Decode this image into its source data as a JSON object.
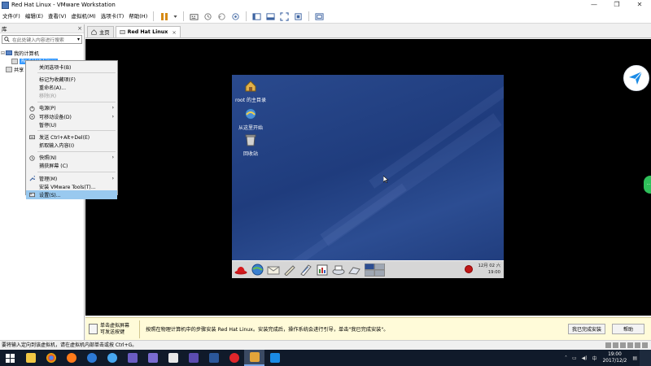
{
  "window": {
    "title": "Red Hat Linux - VMware Workstation",
    "controls": [
      "—",
      "❐",
      "✕"
    ]
  },
  "menubar": {
    "items": [
      "文件(F)",
      "编辑(E)",
      "查看(V)",
      "虚拟机(M)",
      "选项卡(T)",
      "帮助(H)"
    ]
  },
  "library": {
    "title": "库",
    "close": "×",
    "search_placeholder": "在此处键入内容进行搜索",
    "tree": {
      "root_label": "我的计算机",
      "selected_label": "Red Hat Linux",
      "shared_label": "共享"
    }
  },
  "tabs": [
    {
      "label": "主页",
      "active": false
    },
    {
      "label": "Red Hat Linux",
      "active": true,
      "close": "×"
    }
  ],
  "context_menu": {
    "items": [
      {
        "label": "关闭选项卡(B)",
        "disabled": false
      },
      {
        "label": "标记为收藏项(F)",
        "disabled": false,
        "sep_before": true
      },
      {
        "label": "重命名(A)...",
        "disabled": false
      },
      {
        "label": "移除(R)",
        "disabled": true
      },
      {
        "label": "电源(P)",
        "disabled": false,
        "sep_before": true,
        "submenu": true,
        "icon": "power-icon"
      },
      {
        "label": "可移动设备(D)",
        "disabled": false,
        "submenu": true,
        "icon": "disk-icon"
      },
      {
        "label": "暂停(U)",
        "disabled": false
      },
      {
        "label": "发送 Ctrl+Alt+Del(E)",
        "disabled": false,
        "sep_before": true,
        "icon": "keyboard-icon"
      },
      {
        "label": "抓取输入内容(I)",
        "disabled": false
      },
      {
        "label": "快照(N)",
        "disabled": false,
        "sep_before": true,
        "submenu": true,
        "icon": "snapshot-icon"
      },
      {
        "label": "捕获屏幕 (C)",
        "disabled": false
      },
      {
        "label": "管理(M)",
        "disabled": false,
        "sep_before": true,
        "submenu": true,
        "icon": "wrench-icon"
      },
      {
        "label": "安装 VMware Tools(T)...",
        "disabled": false
      },
      {
        "label": "设置(S)...",
        "disabled": false,
        "highlight": true,
        "icon": "settings-icon"
      }
    ],
    "arrow": "›"
  },
  "guest_desktop": {
    "icons": [
      {
        "label": "root 的主目录"
      },
      {
        "label": "从这里开始"
      },
      {
        "label": "回收站"
      }
    ],
    "panel_clock": {
      "date": "12月 02 六",
      "time": "19:00"
    }
  },
  "hintbar": {
    "left_text_line1": "单击虚拟屏幕",
    "left_text_line2": "可发送按键",
    "message": "按照在物理计算机中的步骤安装 Red Hat Linux。安装完成后，操作系统会进行引导，单击\"我已完成安装\"。",
    "done_button": "我已完成安装",
    "help_button": "帮助"
  },
  "statusbar": {
    "text": "要将输入定向到该虚拟机，请在虚拟机内部单击或按 Ctrl+G。"
  },
  "taskbar": {
    "tray": {
      "input_method": "中",
      "time": "19:00",
      "date": "2017/12/2"
    }
  },
  "colors": {
    "accent": "#3399ff",
    "menu_highlight": "#99c9ef",
    "taskbar": "#101a2a",
    "hintbar": "#fffbd9"
  }
}
